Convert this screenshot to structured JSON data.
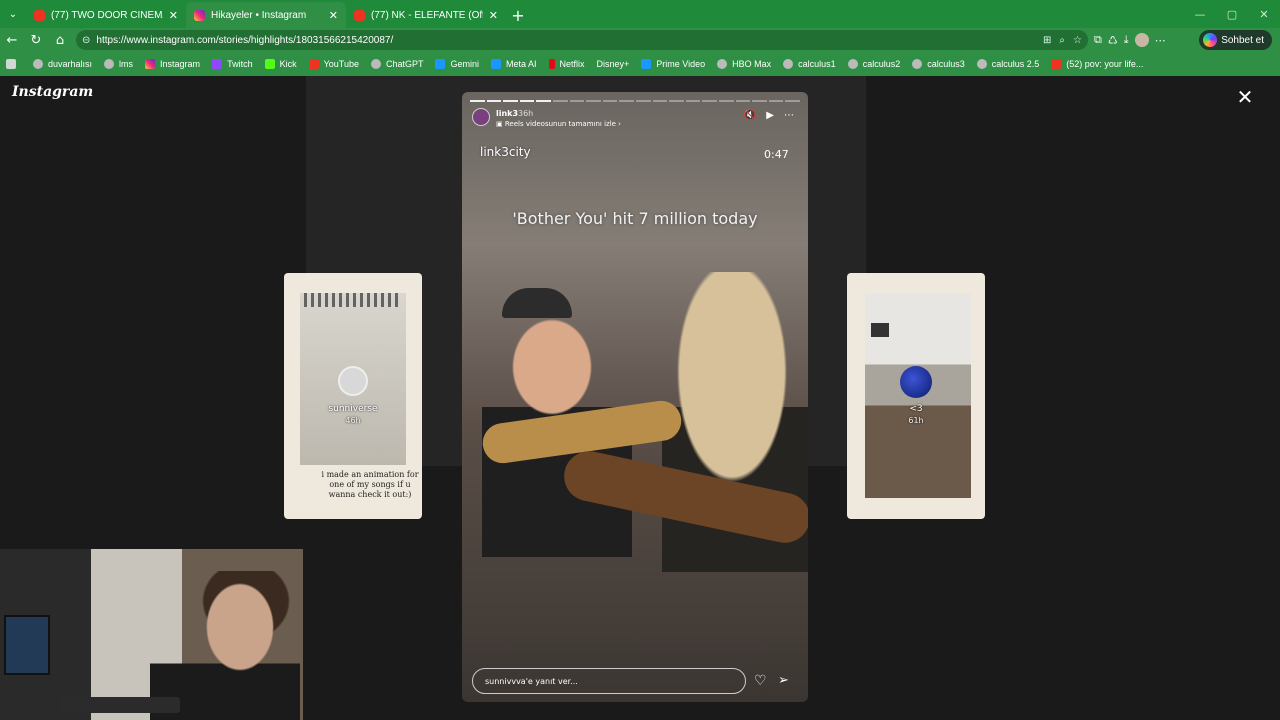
{
  "tabs": [
    {
      "title": "(77) TWO DOOR CINEMA CLUB | S",
      "favicon": "youtube-icon",
      "active": false
    },
    {
      "title": "Hikayeler • Instagram",
      "favicon": "instagram-icon",
      "active": true
    },
    {
      "title": "(77) NK - ELEFANTE (Official Video",
      "favicon": "youtube-icon",
      "active": false
    }
  ],
  "address": {
    "url": "https://www.instagram.com/stories/highlights/18031566215420087/"
  },
  "copilot": {
    "label": "Sohbet et"
  },
  "bookmarks": [
    {
      "label": "duvarhalısı",
      "icon": "grey"
    },
    {
      "label": "lms",
      "icon": "grey"
    },
    {
      "label": "Instagram",
      "icon": "ig"
    },
    {
      "label": "Twitch",
      "icon": "tw"
    },
    {
      "label": "Kick",
      "icon": "kick"
    },
    {
      "label": "YouTube",
      "icon": "red"
    },
    {
      "label": "ChatGPT",
      "icon": "grey"
    },
    {
      "label": "Gemini",
      "icon": "blue"
    },
    {
      "label": "Meta AI",
      "icon": "blue"
    },
    {
      "label": "Netflix",
      "icon": "nf"
    },
    {
      "label": "Disney+",
      "icon": "none"
    },
    {
      "label": "Prime Video",
      "icon": "blue"
    },
    {
      "label": "HBO Max",
      "icon": "grey"
    },
    {
      "label": "calculus1",
      "icon": "grey"
    },
    {
      "label": "calculus2",
      "icon": "grey"
    },
    {
      "label": "calculus3",
      "icon": "grey"
    },
    {
      "label": "calculus 2.5",
      "icon": "grey"
    },
    {
      "label": "(52) pov: your life...",
      "icon": "red"
    }
  ],
  "instagram": {
    "logo_text": "Instagram",
    "left_preview": {
      "username": "sunniverse",
      "time": "46h",
      "caption": "i made an animation for one of my songs if u wanna check it out:)"
    },
    "right_preview": {
      "username": "<3",
      "time": "61h"
    },
    "story": {
      "username": "link3",
      "time": "36h",
      "reel_link": "Reels videosunun tamamını izle",
      "handle_text": "link3city",
      "clock": "0:47",
      "headline": "'Bother You' hit 7 million today",
      "reply_placeholder": "sunnivvva'e yanıt ver..."
    }
  }
}
